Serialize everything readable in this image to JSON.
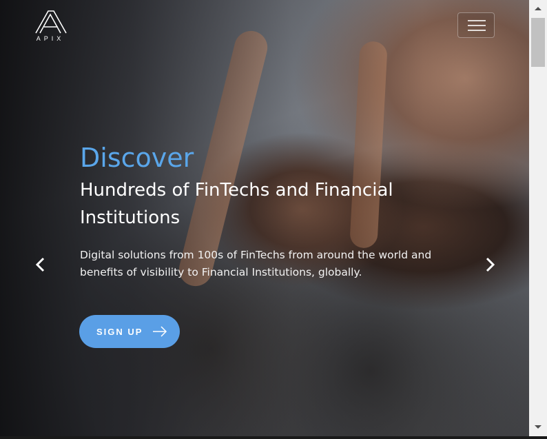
{
  "brand": {
    "logo_text": "APIX",
    "logo_icon": "apix-a-logo"
  },
  "nav": {
    "menu_icon": "hamburger-icon"
  },
  "hero": {
    "discover": "Discover",
    "headline": "Hundreds of FinTechs and Financial Institutions",
    "description": "Digital solutions from 100s of FinTechs from around the world and benefits of visibility to Financial Institutions, globally.",
    "signup_label": "SIGN UP",
    "signup_icon": "arrow-right-icon",
    "prev_icon": "chevron-left-icon",
    "next_icon": "chevron-right-icon"
  },
  "colors": {
    "accent": "#5aa6ea",
    "button": "#5a9fe6"
  }
}
